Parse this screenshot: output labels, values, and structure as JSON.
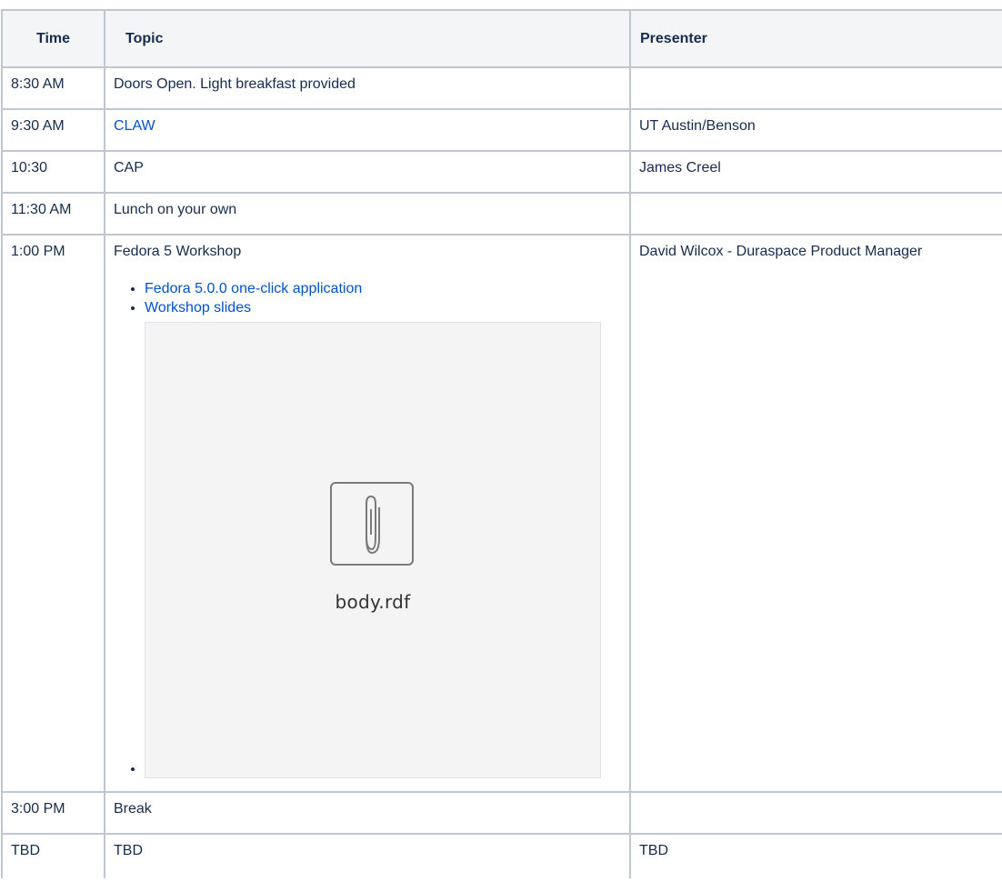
{
  "table": {
    "headers": [
      "Time",
      "Topic",
      "Presenter"
    ],
    "rows": [
      {
        "time": "8:30 AM",
        "topic": "Doors Open. Light breakfast provided",
        "presenter": ""
      },
      {
        "time": "9:30 AM",
        "topic": "CLAW",
        "presenter": "UT Austin/Benson"
      },
      {
        "time": "10:30",
        "topic": "CAP",
        "presenter": "James Creel"
      },
      {
        "time": "11:30 AM",
        "topic": "Lunch on your own",
        "presenter": ""
      },
      {
        "time": "1:00 PM",
        "topic": "Fedora 5 Workshop",
        "presenter": "David Wilcox - Duraspace Product Manager",
        "links": [
          "Fedora 5.0.0 one-click application",
          "Workshop slides"
        ],
        "attachment": {
          "filename": "body.rdf",
          "icon": "paperclip-icon"
        }
      },
      {
        "time": "3:00 PM",
        "topic": "Break",
        "presenter": ""
      },
      {
        "time": "TBD",
        "topic": "TBD",
        "presenter": "TBD"
      }
    ]
  },
  "colors": {
    "link": "#0052cc",
    "header_bg": "#f4f5f7",
    "border": "#c1c7d0",
    "text": "#172b4d"
  }
}
